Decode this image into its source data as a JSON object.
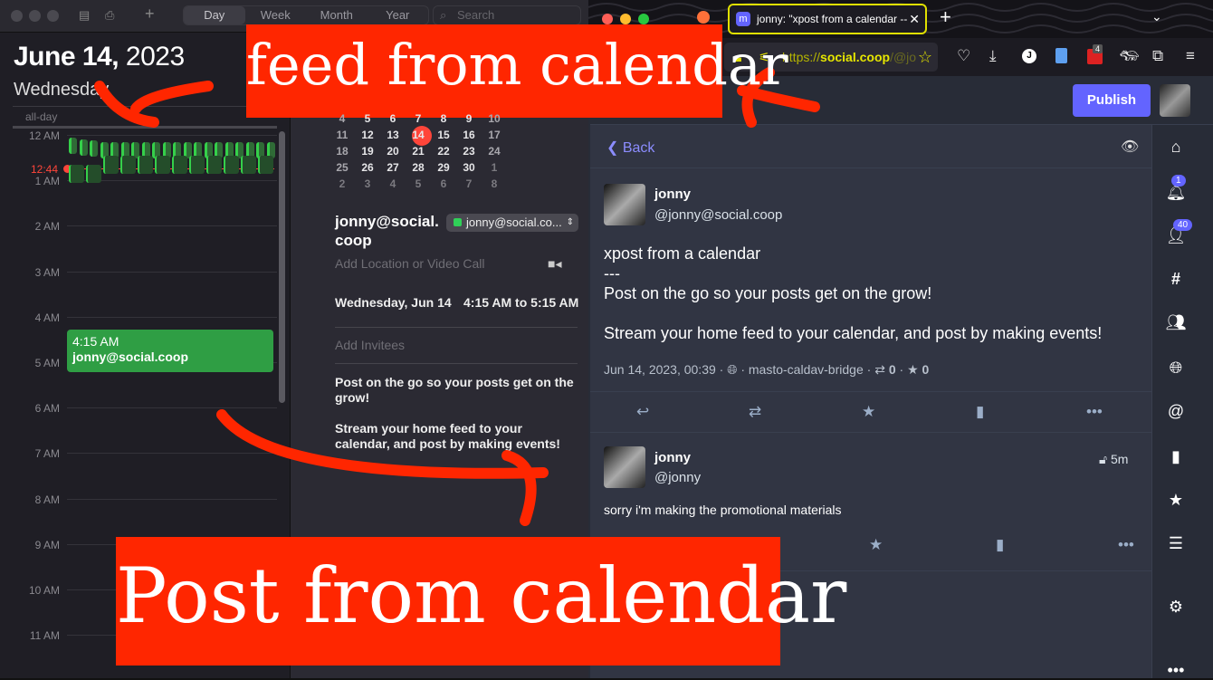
{
  "calendar": {
    "toolbar": {
      "views": [
        "Day",
        "Week",
        "Month",
        "Year"
      ],
      "active_view": "Day",
      "search_placeholder": "Search",
      "add": "+"
    },
    "date_bold": "June 14,",
    "year": "2023",
    "weekday": "Wednesday",
    "allday": "all-day",
    "hours": [
      "12 AM",
      "1 AM",
      "2 AM",
      "3 AM",
      "4 AM",
      "5 AM",
      "6 AM",
      "7 AM",
      "8 AM",
      "9 AM",
      "10 AM",
      "11 AM"
    ],
    "now_time": "12:44",
    "event": {
      "time": "4:15 AM",
      "title": "jonny@social.coop",
      "color": "#2f9e44"
    },
    "mini_calendar": [
      [
        "4",
        "5",
        "6",
        "7",
        "8",
        "9",
        "10"
      ],
      [
        "11",
        "12",
        "13",
        "14",
        "15",
        "16",
        "17"
      ],
      [
        "18",
        "19",
        "20",
        "21",
        "22",
        "23",
        "24"
      ],
      [
        "25",
        "26",
        "27",
        "28",
        "29",
        "30",
        "1"
      ],
      [
        "2",
        "3",
        "4",
        "5",
        "6",
        "7",
        "8"
      ]
    ],
    "today": "14",
    "detail": {
      "title": "jonny@social.coop",
      "calendar_select": "jonny@social.co...",
      "location_placeholder": "Add Location or Video Call",
      "date": "Wednesday, Jun 14",
      "time_range": "4:15 AM to 5:15 AM",
      "invitees_placeholder": "Add Invitees",
      "notes_p1": "Post on the go so your posts get on the grow!",
      "notes_p2": "Stream your home feed to your calendar, and post by making events!"
    }
  },
  "browser": {
    "tab_title": "jonny: \"xpost from a calendar -- ",
    "url_prefix": "https://",
    "url_domain": "social.coop",
    "url_rest": "/@jo",
    "badge_ext": "4"
  },
  "mastodon": {
    "publish": "Publish",
    "back": "Back",
    "post": {
      "name": "jonny",
      "handle": "@jonny@social.coop",
      "title": "xpost from a calendar",
      "divider": "---",
      "p1": "Post on the go so your posts get on the grow!",
      "p2": "Stream your home feed to your calendar, and post by making events!",
      "meta_date": "Jun 14, 2023, 00:39",
      "meta_app": "masto-caldav-bridge",
      "boosts": "0",
      "favs": "0"
    },
    "reply": {
      "name": "jonny",
      "handle": "@jonny",
      "age": "5m",
      "text": "sorry i'm making the promotional materials"
    },
    "nav_badges": {
      "notifications": "1",
      "follow_requests": "40"
    }
  },
  "annotations": {
    "top": "feed from calendar",
    "bottom": "Post from calendar",
    "color": "#ff2600"
  }
}
